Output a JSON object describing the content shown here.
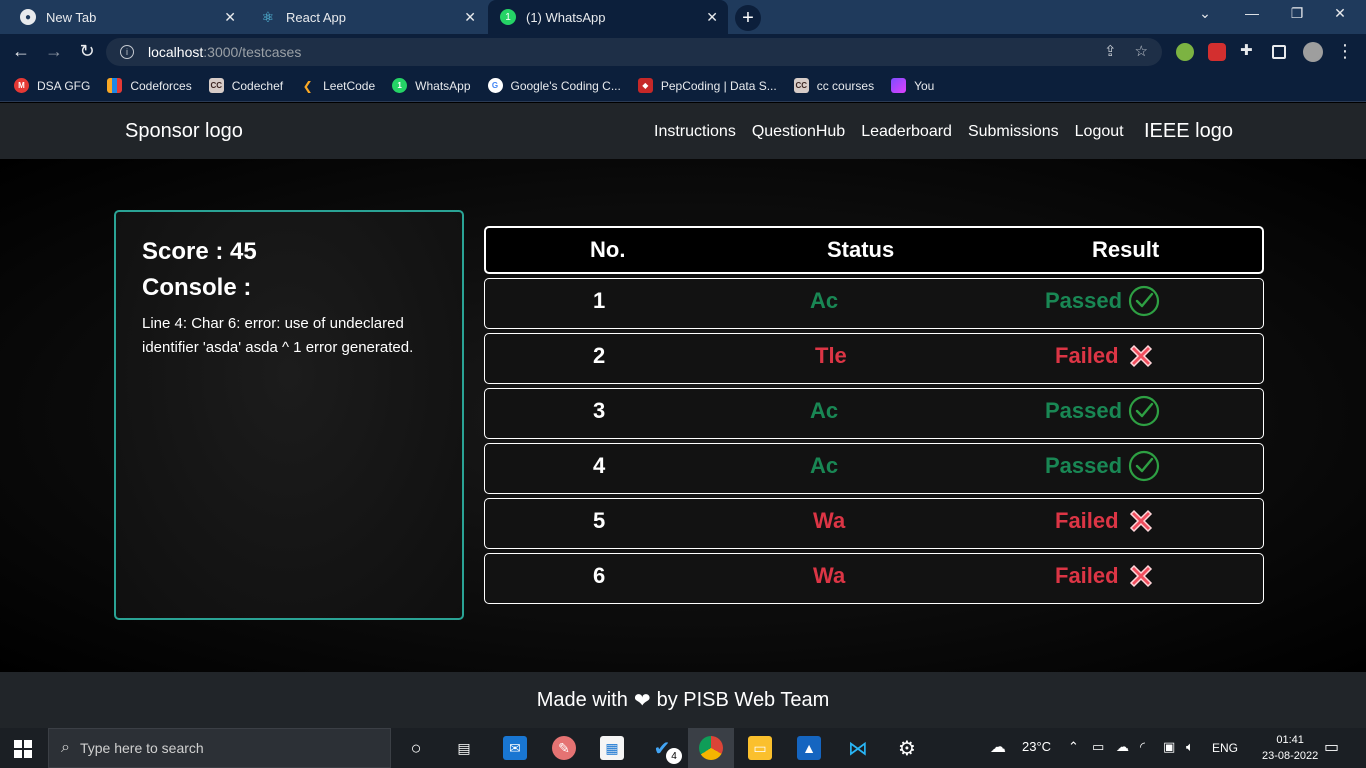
{
  "browser": {
    "tabs": [
      {
        "label": "New Tab",
        "icon": "chrome-icon"
      },
      {
        "label": "React App",
        "icon": "react-icon"
      },
      {
        "label": "(1) WhatsApp",
        "icon": "whatsapp-icon"
      }
    ],
    "url_host": "localhost",
    "url_path": ":3000/testcases",
    "bookmarks": [
      {
        "label": "DSA GFG",
        "color": "#e53935",
        "glyph": "M"
      },
      {
        "label": "Codeforces",
        "color": "#1e88e5",
        "glyph": "▮"
      },
      {
        "label": "Codechef",
        "color": "#5d4037",
        "glyph": "CC"
      },
      {
        "label": "LeetCode",
        "color": "#f9a825",
        "glyph": "L"
      },
      {
        "label": "WhatsApp",
        "color": "#25d366",
        "glyph": "1"
      },
      {
        "label": "Google's Coding C...",
        "color": "#ffffff",
        "glyph": "G"
      },
      {
        "label": "PepCoding | Data S...",
        "color": "#c62828",
        "glyph": "P"
      },
      {
        "label": "cc courses",
        "color": "#5d4037",
        "glyph": "CC"
      },
      {
        "label": "You",
        "color": "#7c4dff",
        "glyph": "Y"
      }
    ]
  },
  "navbar": {
    "brand": "Sponsor logo",
    "links": [
      "Instructions",
      "QuestionHub",
      "Leaderboard",
      "Submissions",
      "Logout"
    ],
    "right_logo": "IEEE logo"
  },
  "console": {
    "score": "Score : 45",
    "title": "Console :",
    "output": "Line 4: Char 6: error: use of undeclared identifier 'asda' asda ^ 1 error generated."
  },
  "results": {
    "headers": [
      "No.",
      "Status",
      "Result"
    ],
    "rows": [
      {
        "no": "1",
        "status": "Ac",
        "result": "Passed",
        "ok": true
      },
      {
        "no": "2",
        "status": "Tle",
        "result": "Failed",
        "ok": false
      },
      {
        "no": "3",
        "status": "Ac",
        "result": "Passed",
        "ok": true
      },
      {
        "no": "4",
        "status": "Ac",
        "result": "Passed",
        "ok": true
      },
      {
        "no": "5",
        "status": "Wa",
        "result": "Failed",
        "ok": false
      },
      {
        "no": "6",
        "status": "Wa",
        "result": "Failed",
        "ok": false
      }
    ]
  },
  "footer": {
    "prefix": "Made with",
    "suffix": "by PISB Web Team"
  },
  "taskbar": {
    "search_placeholder": "Type here to search",
    "badge": "4",
    "weather": "23°C",
    "language": "ENG",
    "time": "01:41",
    "date": "23-08-2022"
  },
  "colors": {
    "pass": "#198754",
    "fail": "#dc3545",
    "card_border": "#2aa395"
  }
}
